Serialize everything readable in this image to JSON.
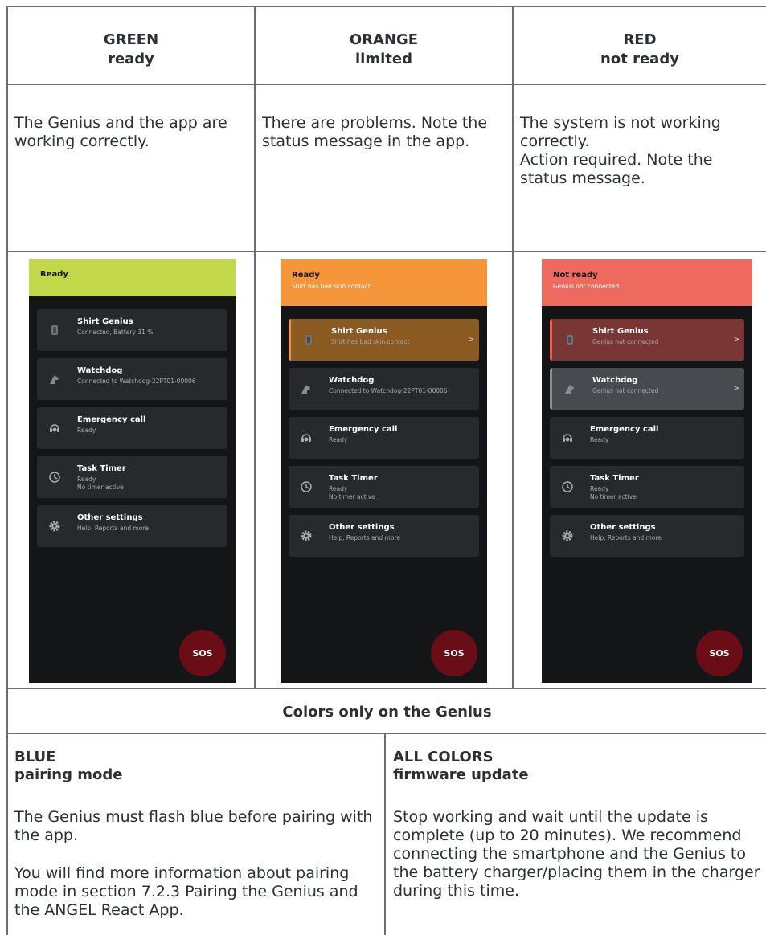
{
  "columns": [
    {
      "color": "GREEN",
      "state": "ready",
      "description": "The Genius and the app are working correctly."
    },
    {
      "color": "ORANGE",
      "state": "limited",
      "description": "There are problems. Note the status message in the app."
    },
    {
      "color": "RED",
      "state": "not ready",
      "description_lines": [
        "The system is not working correctly.",
        "Action required. Note the status message."
      ]
    }
  ],
  "phones": [
    {
      "bar_color": "#c2d84a",
      "title": "Ready",
      "subtitle": "",
      "cards": [
        {
          "title": "Shirt Genius",
          "sub": "Connected, Battery 31 %",
          "icon": "shirt-icon"
        },
        {
          "title": "Watchdog",
          "sub": "Connected to Watchdog-22PT01-00006",
          "icon": "dog-icon"
        },
        {
          "title": "Emergency call",
          "sub": "Ready",
          "icon": "headset-icon"
        },
        {
          "title": "Task Timer",
          "sub": "Ready",
          "sub2": "No timer active",
          "icon": "clock-icon"
        },
        {
          "title": "Other settings",
          "sub": "Help, Reports and more",
          "icon": "gear-icon"
        }
      ],
      "sos": "SOS"
    },
    {
      "bar_color": "#f5963a",
      "title": "Ready",
      "subtitle": "Shirt has bad skin contact",
      "cards": [
        {
          "title": "Shirt Genius",
          "sub": "Shirt has bad skin contact",
          "icon": "shirt-icon",
          "highlight": "#8a5a22",
          "accent": "#f5963a",
          "chevron": ">"
        },
        {
          "title": "Watchdog",
          "sub": "Connected to Watchdog-22PT01-00006",
          "icon": "dog-icon"
        },
        {
          "title": "Emergency call",
          "sub": "Ready",
          "icon": "headset-icon"
        },
        {
          "title": "Task Timer",
          "sub": "Ready",
          "sub2": "No timer active",
          "icon": "clock-icon"
        },
        {
          "title": "Other settings",
          "sub": "Help, Reports and more",
          "icon": "gear-icon"
        }
      ],
      "sos": "SOS"
    },
    {
      "bar_color": "#ee6a5e",
      "title": "Not ready",
      "subtitle": "Genius not connected",
      "cards": [
        {
          "title": "Shirt Genius",
          "sub": "Genius not connected",
          "icon": "shirt-icon",
          "highlight": "#7a3535",
          "accent": "#ee5a4e",
          "chevron": ">"
        },
        {
          "title": "Watchdog",
          "sub": "Genius not connected",
          "icon": "dog-icon",
          "highlight": "#474a4e",
          "accent": "#8a8d90",
          "chevron": ">"
        },
        {
          "title": "Emergency call",
          "sub": "Ready",
          "icon": "headset-icon"
        },
        {
          "title": "Task Timer",
          "sub": "Ready",
          "sub2": "No timer active",
          "icon": "clock-icon"
        },
        {
          "title": "Other settings",
          "sub": "Help, Reports and more",
          "icon": "gear-icon"
        }
      ],
      "sos": "SOS"
    }
  ],
  "genius_section": {
    "title": "Colors only on the Genius",
    "left": {
      "color": "BLUE",
      "state": "pairing mode",
      "p1": "The Genius must flash blue before pairing with the app.",
      "p2": "You will find more information about pairing mode in section 7.2.3 Pairing the Genius and the ANGEL React App."
    },
    "right": {
      "color": "ALL COLORS",
      "state": "firmware update",
      "p1": "Stop working and wait until the update is complete (up to 20 minutes). We recommend connecting the smartphone and the Genius to the battery charger/placing them in the charger during this time."
    }
  }
}
